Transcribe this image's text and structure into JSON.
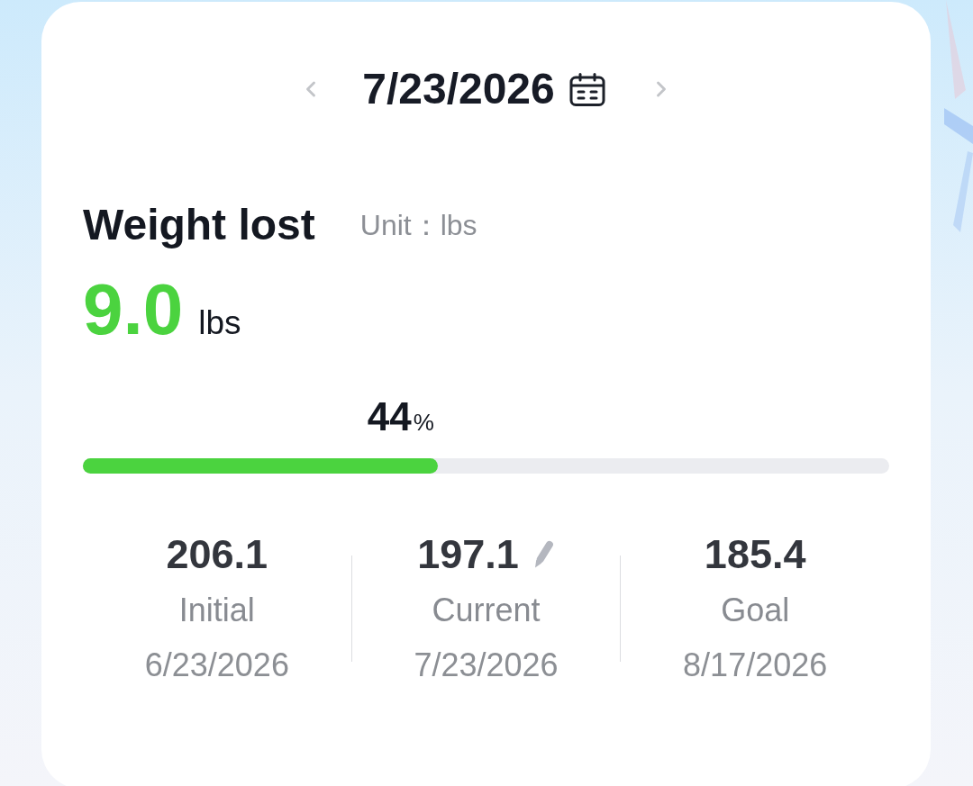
{
  "date_nav": {
    "date": "7/23/2026"
  },
  "summary": {
    "title": "Weight lost",
    "unit_label": "Unit：lbs",
    "value": "9.0",
    "value_unit": "lbs"
  },
  "progress": {
    "percent": "44",
    "sign": "%",
    "level": 0.44
  },
  "stats": [
    {
      "value": "206.1",
      "label": "Initial",
      "date": "6/23/2026",
      "editable": false
    },
    {
      "value": "197.1",
      "label": "Current",
      "date": "7/23/2026",
      "editable": true
    },
    {
      "value": "185.4",
      "label": "Goal",
      "date": "8/17/2026",
      "editable": false
    }
  ]
}
